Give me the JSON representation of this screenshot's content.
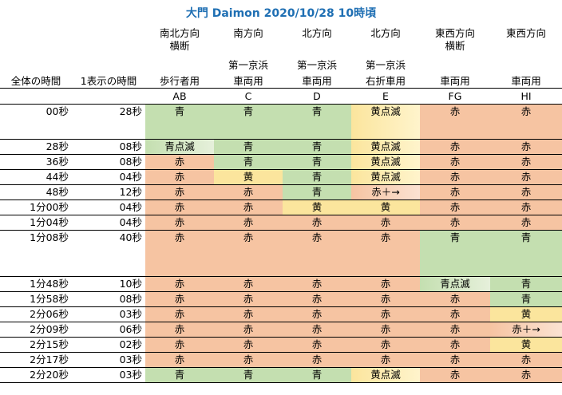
{
  "title": "大門 Daimon 2020/10/28 10時頃",
  "headers": {
    "row1": [
      "",
      "",
      "南北方向\n横断",
      "南方向",
      "北方向",
      "北方向",
      "東西方向\n横断",
      "東西方向"
    ],
    "row2": [
      "",
      "",
      "",
      "第一京浜",
      "第一京浜",
      "第一京浜",
      "",
      ""
    ],
    "row3": [
      "全体の時間",
      "1表示の時間",
      "歩行者用",
      "車両用",
      "車両用",
      "右折車用",
      "車両用",
      "車両用"
    ],
    "row4": [
      "",
      "",
      "AB",
      "C",
      "D",
      "E",
      "FG",
      "HI"
    ]
  },
  "rows": [
    {
      "total": "00秒",
      "dur": "28秒",
      "cells": [
        "青",
        "青",
        "青",
        "黄点滅",
        "赤",
        "赤"
      ]
    },
    {
      "total": "28秒",
      "dur": "08秒",
      "cells": [
        "青点滅",
        "青",
        "青",
        "黄点滅",
        "赤",
        "赤"
      ]
    },
    {
      "total": "36秒",
      "dur": "08秒",
      "cells": [
        "赤",
        "青",
        "青",
        "黄点滅",
        "赤",
        "赤"
      ]
    },
    {
      "total": "44秒",
      "dur": "04秒",
      "cells": [
        "赤",
        "黄",
        "青",
        "黄点滅",
        "赤",
        "赤"
      ]
    },
    {
      "total": "48秒",
      "dur": "12秒",
      "cells": [
        "赤",
        "赤",
        "青",
        "赤＋→",
        "赤",
        "赤"
      ]
    },
    {
      "total": "1分00秒",
      "dur": "04秒",
      "cells": [
        "赤",
        "赤",
        "黄",
        "黄",
        "赤",
        "赤"
      ]
    },
    {
      "total": "1分04秒",
      "dur": "04秒",
      "cells": [
        "赤",
        "赤",
        "赤",
        "赤",
        "赤",
        "赤"
      ]
    },
    {
      "total": "1分08秒",
      "dur": "40秒",
      "cells": [
        "赤",
        "赤",
        "赤",
        "赤",
        "青",
        "青"
      ]
    },
    {
      "total": "1分48秒",
      "dur": "10秒",
      "cells": [
        "赤",
        "赤",
        "赤",
        "赤",
        "青点滅",
        "青"
      ]
    },
    {
      "total": "1分58秒",
      "dur": "08秒",
      "cells": [
        "赤",
        "赤",
        "赤",
        "赤",
        "赤",
        "青"
      ]
    },
    {
      "total": "2分06秒",
      "dur": "03秒",
      "cells": [
        "赤",
        "赤",
        "赤",
        "赤",
        "赤",
        "黄"
      ]
    },
    {
      "total": "2分09秒",
      "dur": "06秒",
      "cells": [
        "赤",
        "赤",
        "赤",
        "赤",
        "赤",
        "赤＋→"
      ]
    },
    {
      "total": "2分15秒",
      "dur": "02秒",
      "cells": [
        "赤",
        "赤",
        "赤",
        "赤",
        "赤",
        "黄"
      ]
    },
    {
      "total": "2分17秒",
      "dur": "03秒",
      "cells": [
        "赤",
        "赤",
        "赤",
        "赤",
        "赤",
        "赤"
      ]
    },
    {
      "total": "2分20秒",
      "dur": "03秒",
      "cells": [
        "青",
        "青",
        "青",
        "黄点滅",
        "赤",
        "赤"
      ]
    }
  ],
  "colors": {
    "green": "#c4dfb0",
    "red": "#f6c4a2",
    "yellow": "#fbe59d",
    "title": "#1f6fb3"
  }
}
